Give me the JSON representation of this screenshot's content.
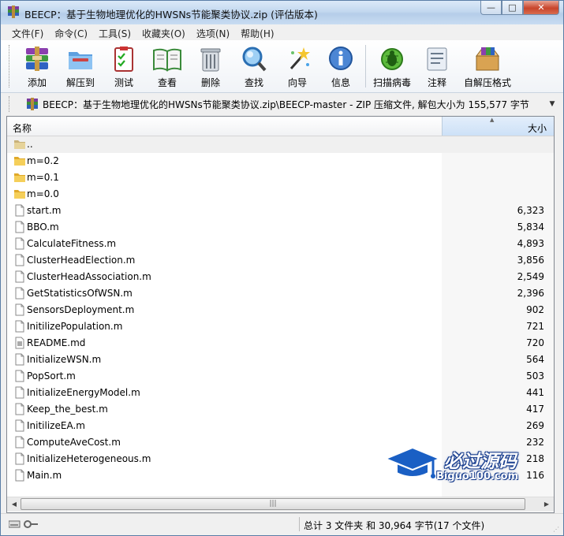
{
  "window": {
    "title": "BEECP：基于生物地理优化的HWSNs节能聚类协议.zip (评估版本)",
    "minimize": "—",
    "maximize": "□",
    "close": "✕"
  },
  "menu": [
    "文件(F)",
    "命令(C)",
    "工具(S)",
    "收藏夹(O)",
    "选项(N)",
    "帮助(H)"
  ],
  "toolbar": [
    {
      "label": "添加",
      "icon": "add-archive-icon"
    },
    {
      "label": "解压到",
      "icon": "extract-folder-icon"
    },
    {
      "label": "测试",
      "icon": "test-clipboard-icon"
    },
    {
      "label": "查看",
      "icon": "view-book-icon"
    },
    {
      "label": "删除",
      "icon": "trash-icon"
    },
    {
      "label": "查找",
      "icon": "magnifier-icon"
    },
    {
      "label": "向导",
      "icon": "wizard-wand-icon"
    },
    {
      "label": "信息",
      "icon": "info-icon"
    },
    {
      "label": "扫描病毒",
      "icon": "virus-bug-icon"
    },
    {
      "label": "注释",
      "icon": "comment-note-icon"
    },
    {
      "label": "自解压格式",
      "icon": "sfx-box-icon"
    }
  ],
  "address": {
    "path": "BEECP：基于生物地理优化的HWSNs节能聚类协议.zip\\BEECP-master - ZIP 压缩文件, 解包大小为 155,577 字节"
  },
  "columns": {
    "name": "名称",
    "size": "大小"
  },
  "files": [
    {
      "name": "..",
      "size": "",
      "type": "parent"
    },
    {
      "name": "m=0.2",
      "size": "",
      "type": "folder"
    },
    {
      "name": "m=0.1",
      "size": "",
      "type": "folder"
    },
    {
      "name": "m=0.0",
      "size": "",
      "type": "folder"
    },
    {
      "name": "start.m",
      "size": "6,323",
      "type": "file"
    },
    {
      "name": "BBO.m",
      "size": "5,834",
      "type": "file"
    },
    {
      "name": "CalculateFitness.m",
      "size": "4,893",
      "type": "file"
    },
    {
      "name": "ClusterHeadElection.m",
      "size": "3,856",
      "type": "file"
    },
    {
      "name": "ClusterHeadAssociation.m",
      "size": "2,549",
      "type": "file"
    },
    {
      "name": "GetStatisticsOfWSN.m",
      "size": "2,396",
      "type": "file"
    },
    {
      "name": "SensorsDeployment.m",
      "size": "902",
      "type": "file"
    },
    {
      "name": "InitilizePopulation.m",
      "size": "721",
      "type": "file"
    },
    {
      "name": "README.md",
      "size": "720",
      "type": "doc"
    },
    {
      "name": "InitializeWSN.m",
      "size": "564",
      "type": "file"
    },
    {
      "name": "PopSort.m",
      "size": "503",
      "type": "file"
    },
    {
      "name": "InitializeEnergyModel.m",
      "size": "441",
      "type": "file"
    },
    {
      "name": "Keep_the_best.m",
      "size": "417",
      "type": "file"
    },
    {
      "name": "InitilizeEA.m",
      "size": "269",
      "type": "file"
    },
    {
      "name": "ComputeAveCost.m",
      "size": "232",
      "type": "file"
    },
    {
      "name": "InitializeHeterogeneous.m",
      "size": "218",
      "type": "file"
    },
    {
      "name": "Main.m",
      "size": "116",
      "type": "file"
    }
  ],
  "status": {
    "summary": "总计 3 文件夹 和 30,964 字节(17 个文件)"
  },
  "watermark": {
    "title": "必过源码",
    "url": "Biguo100.com"
  },
  "colors": {
    "folder": "#f2c447",
    "accent": "#1a3f8f",
    "selection_column": "#f7f7f7"
  }
}
